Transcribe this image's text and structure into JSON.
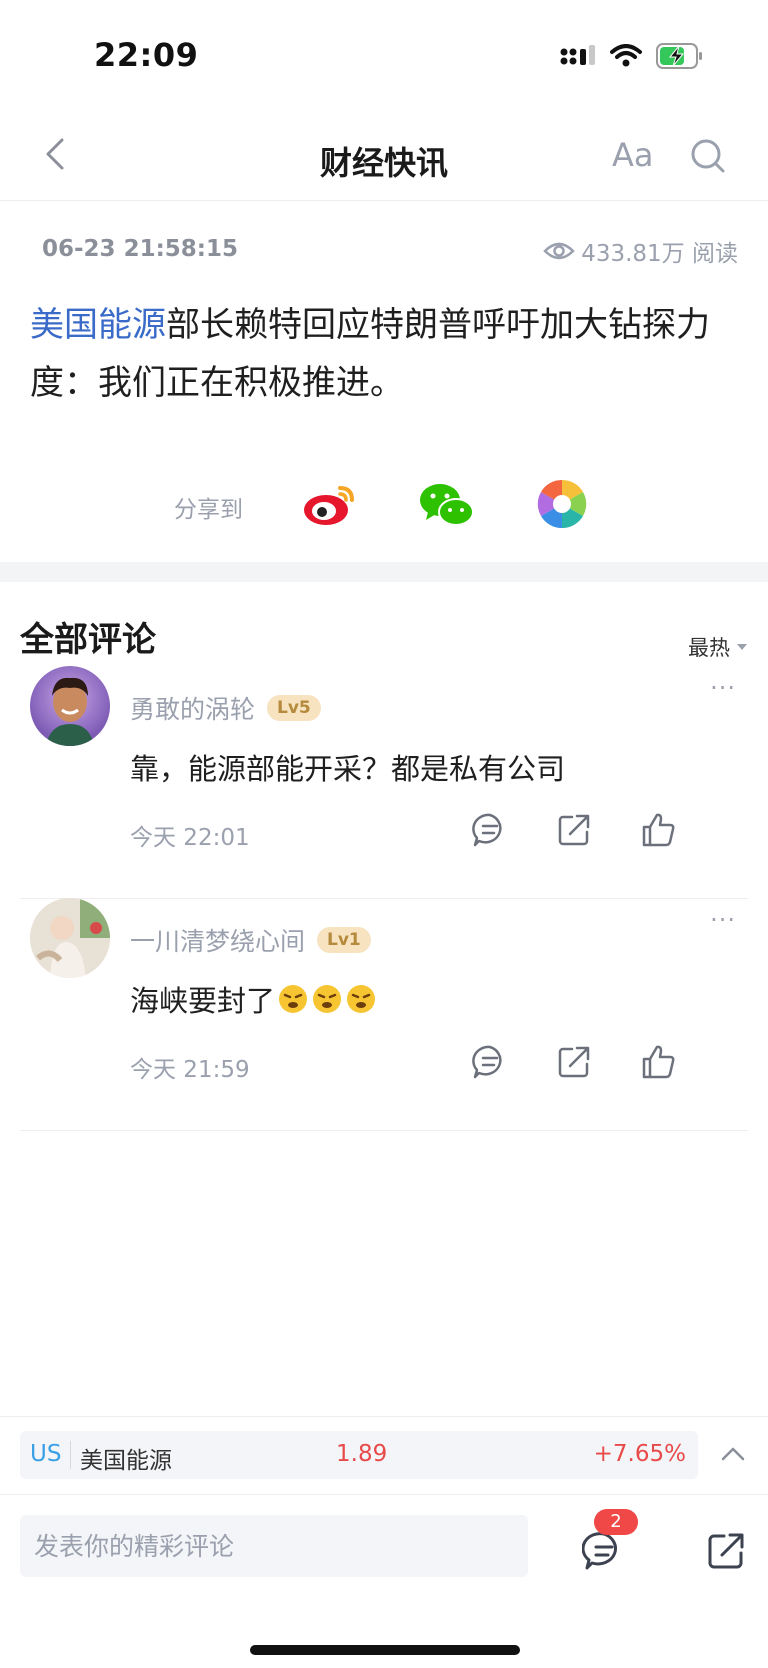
{
  "status_bar": {
    "time": "22:09"
  },
  "nav": {
    "title": "财经快讯",
    "font_button": "Aa"
  },
  "article": {
    "time": "06-23 21:58:15",
    "views": "433.81万 阅读",
    "headline_link": "美国能源",
    "headline_rest": "部长赖特回应特朗普呼吁加大钻探力度：我们正在积极推进。"
  },
  "share": {
    "label": "分享到",
    "targets": [
      "weibo-icon",
      "wechat-icon",
      "moments-icon"
    ]
  },
  "comments": {
    "title": "全部评论",
    "sort": "最热",
    "items": [
      {
        "user": "勇敢的涡轮",
        "level": "Lv5",
        "text": "靠，能源部能开采？都是私有公司",
        "time": "今天 22:01",
        "more": "···"
      },
      {
        "user": "一川清梦绕心间",
        "level": "Lv1",
        "text": "海峡要封了",
        "time": "今天 21:59",
        "more": "···"
      }
    ]
  },
  "stock": {
    "market": "US",
    "name": "美国能源",
    "price": "1.89",
    "change": "+7.65%"
  },
  "bottom_bar": {
    "input_placeholder": "发表你的精彩评论",
    "comment_count": "2"
  },
  "colors": {
    "link": "#3a6bc8",
    "up": "#e84a4a",
    "badge": "#f04747",
    "muted": "#9aa0ad"
  }
}
